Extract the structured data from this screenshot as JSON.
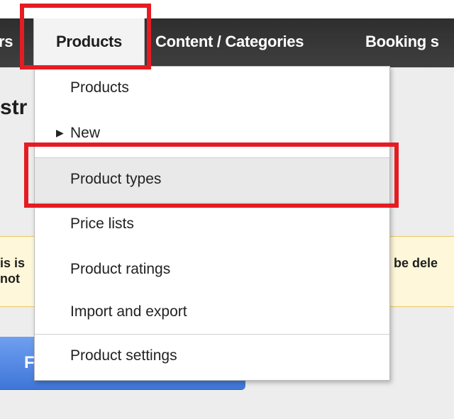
{
  "nav": {
    "items": [
      {
        "label": "rs"
      },
      {
        "label": "Products"
      },
      {
        "label": "Content / Categories"
      },
      {
        "label": "Booking s"
      }
    ]
  },
  "page": {
    "heading": "str",
    "warning_left_line1": "is is",
    "warning_left_line2": "not",
    "warning_right": "be dele",
    "button_label": "F"
  },
  "dropdown": {
    "items": [
      {
        "label": "Products"
      },
      {
        "label": "New"
      },
      {
        "label": "Product types"
      },
      {
        "label": "Price lists"
      },
      {
        "label": "Product ratings"
      },
      {
        "label": "Import and export"
      },
      {
        "label": "Product settings"
      }
    ]
  },
  "icons": {
    "submenu_arrow": "triangle-right-icon"
  },
  "colors": {
    "highlight": "#e51c23",
    "nav_background": "#3a3a3a",
    "warning_background": "#fff7d9",
    "button_blue": "#4f86e6"
  }
}
